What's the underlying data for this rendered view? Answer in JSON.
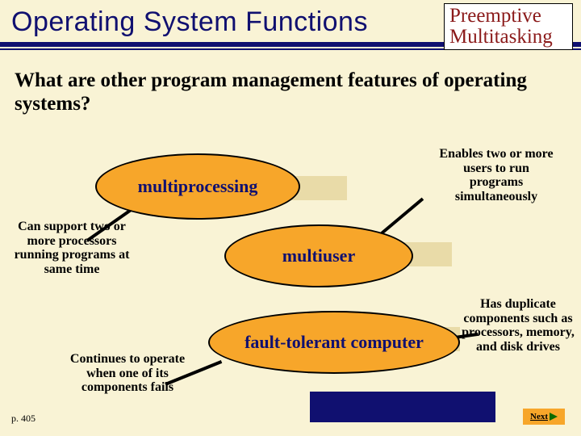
{
  "header": {
    "title": "Operating System Functions",
    "callout_l1": "Preemptive",
    "callout_l2": "Multitasking"
  },
  "question": "What are other program management features of operating systems?",
  "bubbles": {
    "multiprocessing": "multiprocessing",
    "multiuser": "multiuser",
    "fault_tolerant": "fault-tolerant computer"
  },
  "notes": {
    "can_support": "Can support two or more processors running programs at same time",
    "enables": "Enables two or more users to run programs simultaneously",
    "continues": "Continues to operate when one of its components fails",
    "duplicate": "Has duplicate components such as processors, memory, and disk drives"
  },
  "footer": {
    "page_ref": "p. 405",
    "next": "Next"
  }
}
